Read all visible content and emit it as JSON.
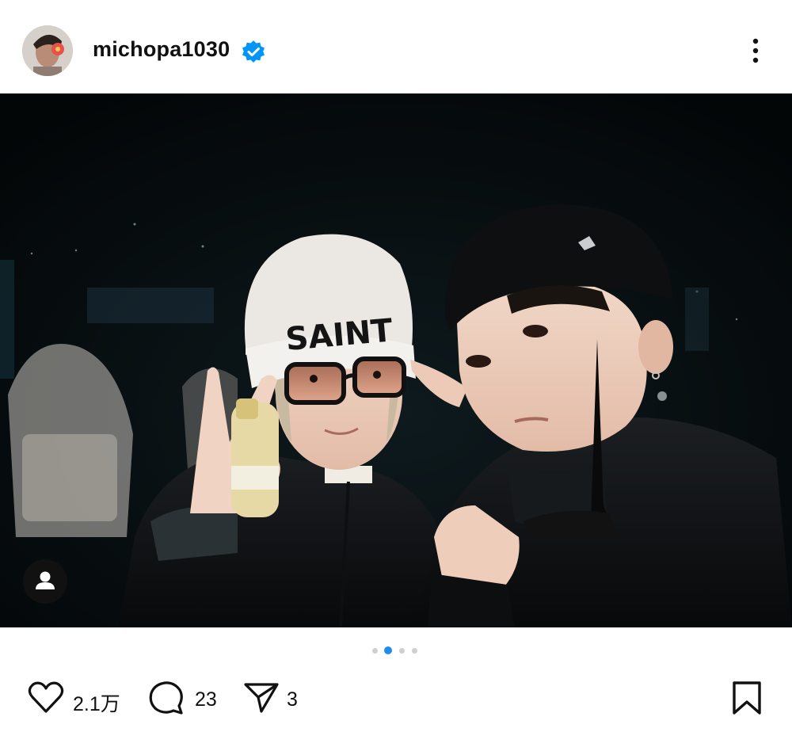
{
  "post": {
    "username": "michopa1030",
    "verified_icon": "verified-badge-icon",
    "more_icon": "more-vertical-icon"
  },
  "carousel": {
    "total": 4,
    "active_index": 1
  },
  "photo": {
    "beanie_text": "SAINT",
    "tag_icon": "user-tag-icon"
  },
  "actions": {
    "likes": "2.1万",
    "comments": "23",
    "shares": "3",
    "like_icon": "heart-icon",
    "comment_icon": "comment-bubble-icon",
    "share_icon": "send-icon",
    "save_icon": "bookmark-icon"
  },
  "colors": {
    "verified": "#0095f6",
    "active_dot": "#1d8ef0",
    "inactive_dot": "#cfcfcf"
  }
}
